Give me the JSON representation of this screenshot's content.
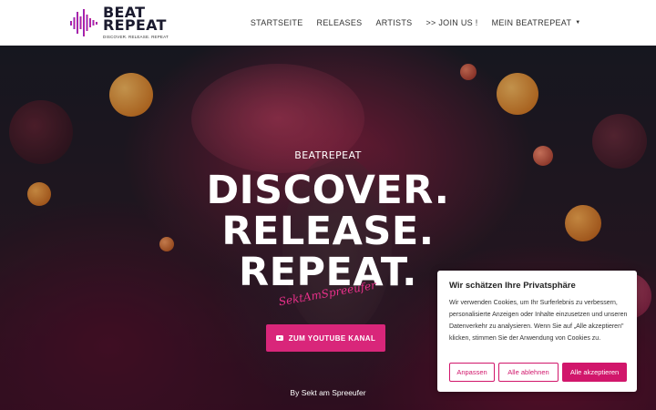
{
  "brand": {
    "name_line1": "BEAT",
    "name_line2": "REPEAT",
    "tagline": "DISCOVER. RELEASE. REPEAT",
    "accent_color": "#d9267a",
    "logo_gradient": [
      "#6b2bd9",
      "#e0207a"
    ]
  },
  "nav": {
    "items": [
      {
        "label": "STARTSEITE"
      },
      {
        "label": "RELEASES"
      },
      {
        "label": "ARTISTS"
      },
      {
        "label": ">> JOIN US !"
      },
      {
        "label": "MEIN BEATREPEAT",
        "icon": "caret-down-icon"
      }
    ]
  },
  "hero": {
    "eyebrow": "BEATREPEAT",
    "headline": [
      "DISCOVER.",
      "RELEASE.",
      "REPEAT."
    ],
    "signature": "SektAmSpreeufer",
    "button_label": "ZUM YOUTUBE KANAL",
    "button_icon": "youtube-icon",
    "byline": "By Sekt am Spreeufer"
  },
  "cookie": {
    "title": "Wir schätzen Ihre Privatsphäre",
    "text": "Wir verwenden Cookies, um Ihr Surferlebnis zu verbessern, personalisierte Anzeigen oder Inhalte einzusetzen und unseren Datenverkehr zu analysieren. Wenn Sie auf „Alle akzeptieren\" klicken, stimmen Sie der Anwendung von Cookies zu.",
    "buttons": {
      "customize": "Anpassen",
      "reject": "Alle ablehnen",
      "accept": "Alle akzeptieren"
    },
    "accent_color": "#d1166b"
  }
}
